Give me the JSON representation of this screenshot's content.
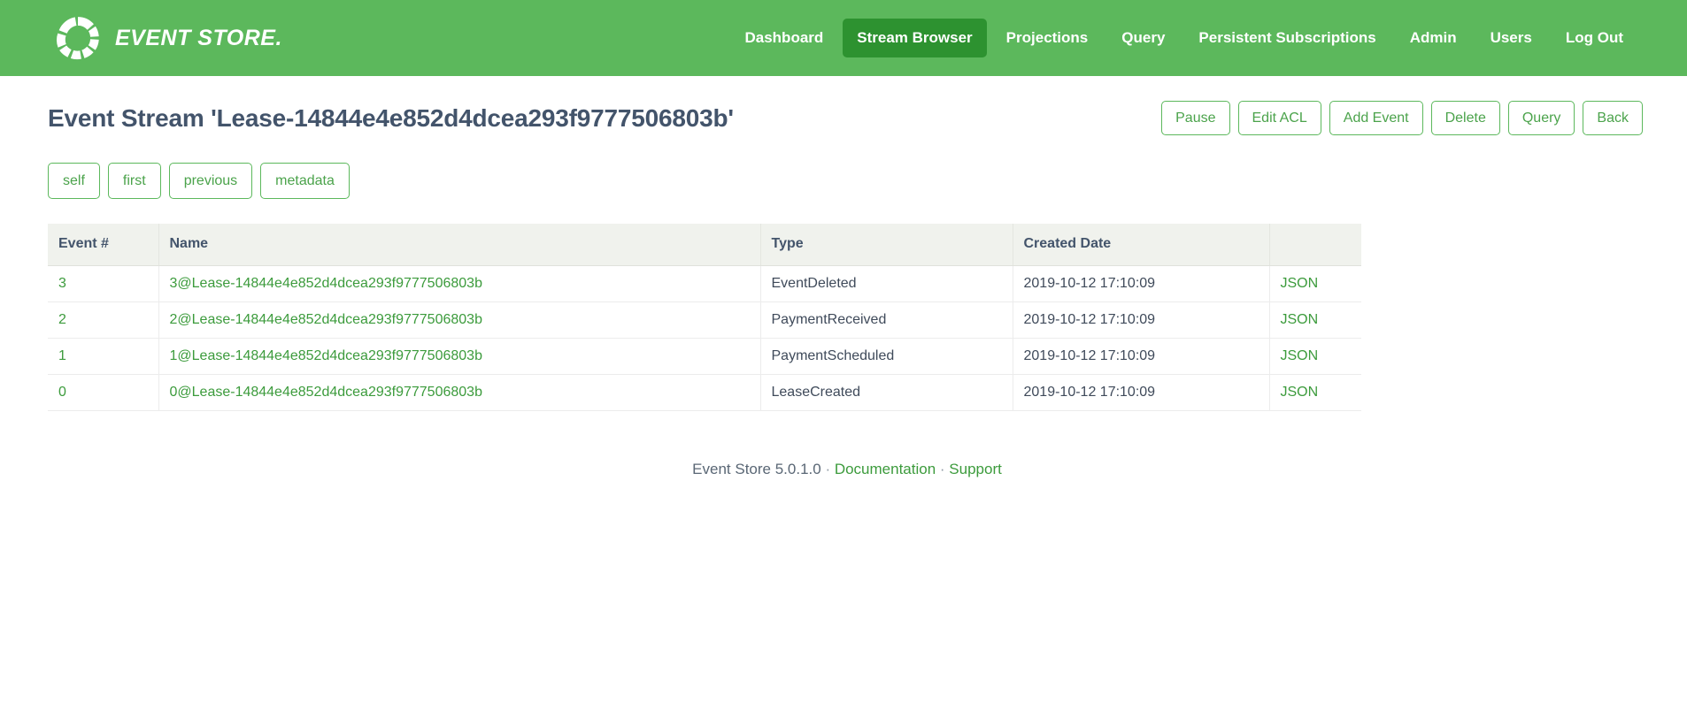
{
  "brand": {
    "name": "EVENT STORE.",
    "logo_icon": "event-store-ring-logo"
  },
  "nav": {
    "items": [
      {
        "label": "Dashboard",
        "active": false
      },
      {
        "label": "Stream Browser",
        "active": true
      },
      {
        "label": "Projections",
        "active": false
      },
      {
        "label": "Query",
        "active": false
      },
      {
        "label": "Persistent Subscriptions",
        "active": false
      },
      {
        "label": "Admin",
        "active": false
      },
      {
        "label": "Users",
        "active": false
      },
      {
        "label": "Log Out",
        "active": false
      }
    ]
  },
  "page": {
    "title": "Event Stream 'Lease-14844e4e852d4dcea293f9777506803b'",
    "actions": [
      {
        "label": "Pause"
      },
      {
        "label": "Edit ACL"
      },
      {
        "label": "Add Event"
      },
      {
        "label": "Delete"
      },
      {
        "label": "Query"
      },
      {
        "label": "Back"
      }
    ],
    "sub_nav": [
      {
        "label": "self"
      },
      {
        "label": "first"
      },
      {
        "label": "previous"
      },
      {
        "label": "metadata"
      }
    ]
  },
  "table": {
    "columns": [
      "Event #",
      "Name",
      "Type",
      "Created Date",
      ""
    ],
    "rows": [
      {
        "number": "3",
        "name": "3@Lease-14844e4e852d4dcea293f9777506803b",
        "type": "EventDeleted",
        "created_date": "2019-10-12 17:10:09",
        "format": "JSON"
      },
      {
        "number": "2",
        "name": "2@Lease-14844e4e852d4dcea293f9777506803b",
        "type": "PaymentReceived",
        "created_date": "2019-10-12 17:10:09",
        "format": "JSON"
      },
      {
        "number": "1",
        "name": "1@Lease-14844e4e852d4dcea293f9777506803b",
        "type": "PaymentScheduled",
        "created_date": "2019-10-12 17:10:09",
        "format": "JSON"
      },
      {
        "number": "0",
        "name": "0@Lease-14844e4e852d4dcea293f9777506803b",
        "type": "LeaseCreated",
        "created_date": "2019-10-12 17:10:09",
        "format": "JSON"
      }
    ]
  },
  "footer": {
    "version_text": "Event Store 5.0.1.0",
    "separator": " · ",
    "documentation_label": "Documentation",
    "support_label": "Support"
  },
  "colors": {
    "brand_green": "#5cb85c",
    "active_nav_green": "#2d9230",
    "link_green": "#3c9b3c",
    "title_slate": "#43546b",
    "table_header_bg": "#f0f2ed"
  }
}
